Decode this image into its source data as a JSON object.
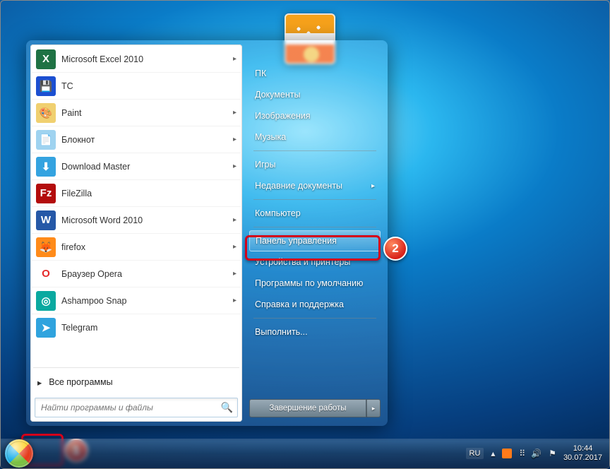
{
  "start_menu": {
    "apps": [
      {
        "label": "Microsoft Excel 2010",
        "has_submenu": true,
        "icon": "excel"
      },
      {
        "label": "TC",
        "has_submenu": false,
        "icon": "tc"
      },
      {
        "label": "Paint",
        "has_submenu": true,
        "icon": "paint"
      },
      {
        "label": "Блокнот",
        "has_submenu": true,
        "icon": "notepad"
      },
      {
        "label": "Download Master",
        "has_submenu": true,
        "icon": "dm"
      },
      {
        "label": "FileZilla",
        "has_submenu": false,
        "icon": "filezilla"
      },
      {
        "label": "Microsoft Word 2010",
        "has_submenu": true,
        "icon": "word"
      },
      {
        "label": "firefox",
        "has_submenu": true,
        "icon": "firefox"
      },
      {
        "label": "Браузер Opera",
        "has_submenu": true,
        "icon": "opera"
      },
      {
        "label": "Ashampoo Snap",
        "has_submenu": true,
        "icon": "snap"
      },
      {
        "label": "Telegram",
        "has_submenu": false,
        "icon": "telegram"
      }
    ],
    "all_programs": "Все программы",
    "search_placeholder": "Найти программы и файлы",
    "right_groups": [
      [
        "ПК",
        "Документы",
        "Изображения",
        "Музыка"
      ],
      [
        "Игры",
        "Недавние документы"
      ],
      [
        "Компьютер"
      ],
      [
        "Панель управления",
        "Устройства и принтеры",
        "Программы по умолчанию",
        "Справка и поддержка"
      ],
      [
        "Выполнить..."
      ]
    ],
    "right_submenu_items": [
      "Недавние документы"
    ],
    "highlighted_right_item": "Панель управления",
    "shutdown_label": "Завершение работы"
  },
  "callouts": {
    "badge1": "1",
    "badge2": "2"
  },
  "taskbar": {
    "language": "RU",
    "time": "10:44",
    "date": "30.07.2017"
  },
  "icon_styles": {
    "excel": {
      "bg": "#1f7244",
      "glyph": "X"
    },
    "tc": {
      "bg": "#1b4fd1",
      "glyph": "💾"
    },
    "paint": {
      "bg": "#f0d070",
      "glyph": "🎨"
    },
    "notepad": {
      "bg": "#9fd3f0",
      "glyph": "📄"
    },
    "dm": {
      "bg": "#34a3e0",
      "glyph": "⬇"
    },
    "filezilla": {
      "bg": "#b30c0c",
      "glyph": "Fz"
    },
    "word": {
      "bg": "#2558a7",
      "glyph": "W"
    },
    "firefox": {
      "bg": "#ff8b1a",
      "glyph": "🦊"
    },
    "opera": {
      "bg": "#ffffff",
      "glyph": "O",
      "fg": "#e52a2a"
    },
    "snap": {
      "bg": "#0aa9a0",
      "glyph": "◎"
    },
    "telegram": {
      "bg": "#2fa3de",
      "glyph": "➤"
    }
  }
}
